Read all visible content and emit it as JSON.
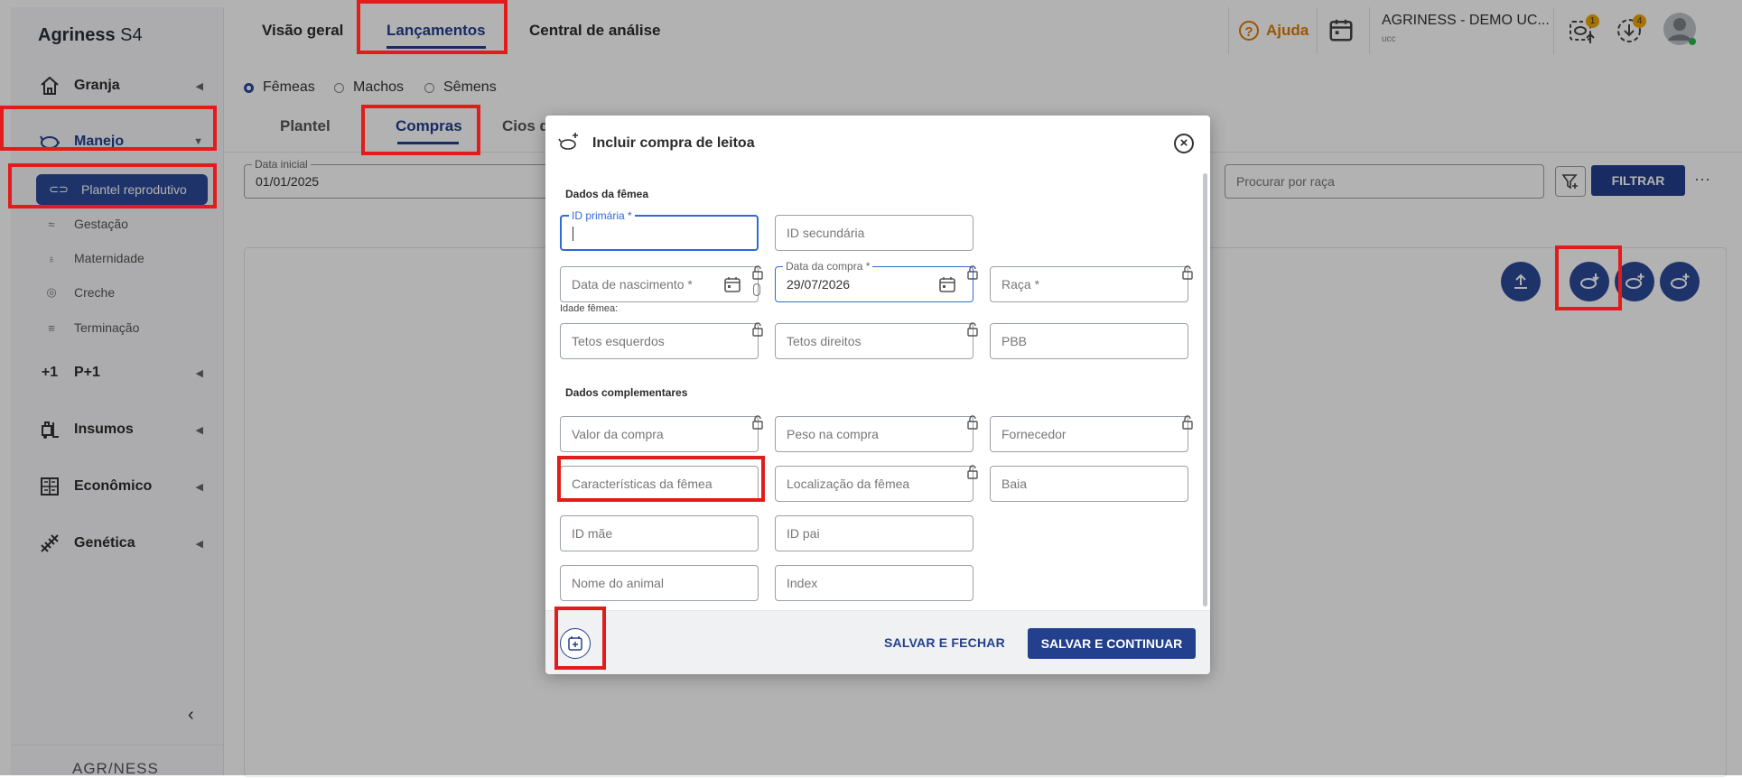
{
  "brand": {
    "name": "Agriness",
    "suffix": "S4"
  },
  "sidebar": {
    "items": [
      {
        "label": "Granja",
        "icon": "home-icon"
      },
      {
        "label": "Manejo",
        "icon": "pig-icon"
      },
      {
        "label": "P+1",
        "icon": "plus-one-icon"
      },
      {
        "label": "Insumos",
        "icon": "forklift-icon"
      },
      {
        "label": "Econômico",
        "icon": "calculator-icon"
      },
      {
        "label": "Genética",
        "icon": "dna-icon"
      }
    ],
    "subitems": [
      {
        "label": "Plantel reprodutivo"
      },
      {
        "label": "Gestação"
      },
      {
        "label": "Maternidade"
      },
      {
        "label": "Creche"
      },
      {
        "label": "Terminação"
      }
    ],
    "footer_logo": "AGR/NESS"
  },
  "topbar": {
    "tabs": [
      "Visão geral",
      "Lançamentos",
      "Central de análise"
    ],
    "help": "Ajuda",
    "farm_name": "AGRINESS - DEMO UC...",
    "farm_sub": "ucc",
    "badge1": "1",
    "badge2": "4"
  },
  "content": {
    "radios": [
      "Fêmeas",
      "Machos",
      "Sêmens"
    ],
    "subtabs": [
      "Plantel",
      "Compras",
      "Cios d"
    ],
    "date_label": "Data inicial",
    "date_value": "01/01/2025",
    "search_race_placeholder": "Procurar por raça",
    "filter_button": "FILTRAR",
    "more": "···"
  },
  "modal": {
    "title": "Incluir compra de leitoa",
    "section1": "Dados da fêmea",
    "section2": "Dados complementares",
    "fields": {
      "id_primaria": "ID primária *",
      "id_secundaria": "ID secundária",
      "data_nascimento": "Data de nascimento *",
      "data_compra_label": "Data da compra *",
      "data_compra_value": "29/07/2026",
      "raca": "Raça *",
      "idade": "Idade fêmea:",
      "tetos_esq": "Tetos esquerdos",
      "tetos_dir": "Tetos direitos",
      "pbb": "PBB",
      "valor": "Valor da compra",
      "peso": "Peso na compra",
      "fornecedor": "Fornecedor",
      "caracteristicas": "Características da fêmea",
      "localizacao": "Localização da fêmea",
      "baia": "Baia",
      "id_mae": "ID mãe",
      "id_pai": "ID pai",
      "nome": "Nome do animal",
      "index": "Index"
    },
    "btn_save_close": "SALVAR E FECHAR",
    "btn_save_continue": "SALVAR E CONTINUAR"
  }
}
